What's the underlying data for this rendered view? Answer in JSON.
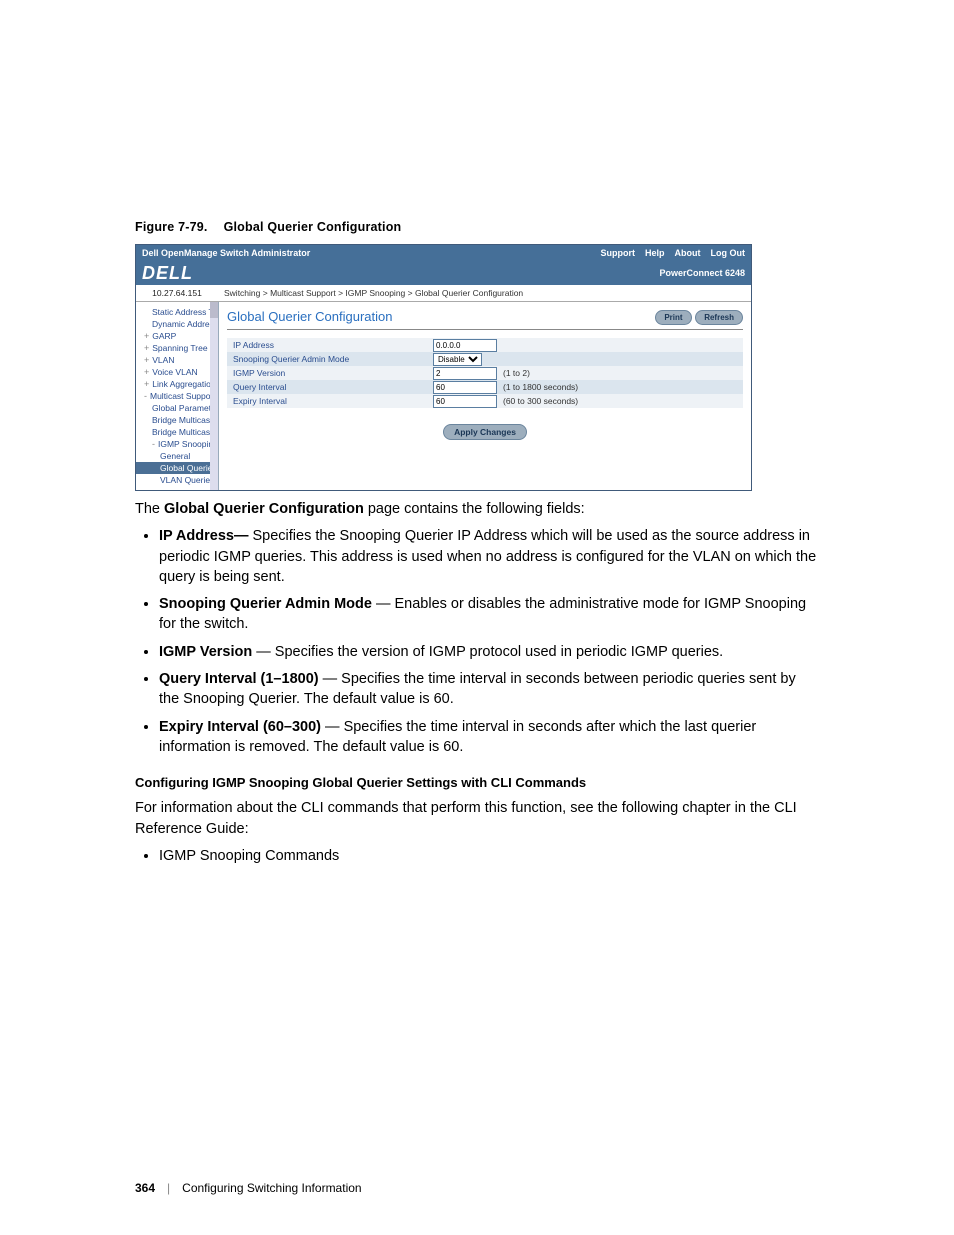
{
  "figure": {
    "label": "Figure 7-79.",
    "title": "Global Querier Configuration"
  },
  "app": {
    "window_title": "Dell OpenManage Switch Administrator",
    "top_links": {
      "support": "Support",
      "help": "Help",
      "about": "About",
      "logout": "Log Out"
    },
    "brand": "DELL",
    "model": "PowerConnect 6248",
    "device_ip": "10.27.64.151",
    "breadcrumb": "Switching > Multicast Support > IGMP Snooping > Global Querier Configuration",
    "page_title": "Global Querier Configuration",
    "buttons": {
      "print": "Print",
      "refresh": "Refresh",
      "apply": "Apply Changes"
    },
    "tree": {
      "static_addr": "Static Address Ta",
      "dynamic_addr": "Dynamic Addres",
      "garp": "GARP",
      "spanning_tree": "Spanning Tree",
      "vlan": "VLAN",
      "voice_vlan": "Voice VLAN",
      "link_agg": "Link Aggregation",
      "mcast_support": "Multicast Support",
      "global_params": "Global Paramet",
      "bridge_mcast1": "Bridge Multicast",
      "bridge_mcast2": "Bridge Multicast",
      "igmp_snooping": "IGMP Snooping",
      "general": "General",
      "global_querier": "Global Querie",
      "vlan_querier": "VLAN Querier"
    },
    "fields": {
      "ip_label": "IP Address",
      "ip_value": "0.0.0.0",
      "mode_label": "Snooping Querier Admin Mode",
      "mode_value": "Disable",
      "version_label": "IGMP Version",
      "version_value": "2",
      "version_hint": "(1 to 2)",
      "qint_label": "Query Interval",
      "qint_value": "60",
      "qint_hint": "(1 to 1800 seconds)",
      "eint_label": "Expiry Interval",
      "eint_value": "60",
      "eint_hint": "(60 to 300 seconds)"
    }
  },
  "body": {
    "intro_pre": "The ",
    "intro_bold": "Global Querier Configuration",
    "intro_post": " page contains the following fields:",
    "b1_lead": "IP Address— ",
    "b1_rest": "Specifies the Snooping Querier IP Address which will be used as the source address in periodic IGMP queries. This address is used when no address is configured for the VLAN on which the query is being sent.",
    "b2_lead": "Snooping Querier Admin Mode",
    "b2_rest": " — Enables or disables the administrative mode for IGMP Snooping for the switch.",
    "b3_lead": "IGMP Version",
    "b3_rest": " — Specifies the version of IGMP protocol used in periodic IGMP queries.",
    "b4_lead": "Query Interval (1–1800)",
    "b4_rest": " — Specifies the time interval in seconds between periodic queries sent by the Snooping Querier. The default value is 60.",
    "b5_lead": "Expiry Interval (60–300)",
    "b5_rest": " — Specifies the time interval in seconds after which the last querier information is removed. The default value is 60.",
    "section_heading": "Configuring IGMP Snooping Global Querier Settings with CLI Commands",
    "section_para": "For information about the CLI commands that perform this function, see the following chapter in the CLI Reference Guide:",
    "section_bullet": "IGMP Snooping Commands"
  },
  "footer": {
    "pagenum": "364",
    "chapter": "Configuring Switching Information"
  }
}
